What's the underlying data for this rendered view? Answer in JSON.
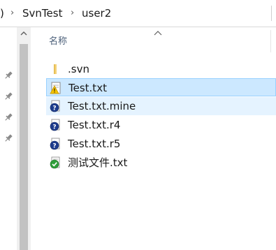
{
  "breadcrumb": {
    "leading_glyph": ")",
    "separator": "›",
    "segments": [
      "SvnTest",
      "user2"
    ]
  },
  "file_list": {
    "column_header": "名称",
    "sort": "ascending",
    "items": [
      {
        "name": ".svn",
        "icon": "folder-icon",
        "state": "normal"
      },
      {
        "name": "Test.txt",
        "icon": "svn-conflict-icon",
        "state": "selected-focused"
      },
      {
        "name": "Test.txt.mine",
        "icon": "svn-unversioned-icon",
        "state": "selected"
      },
      {
        "name": "Test.txt.r4",
        "icon": "svn-unversioned-icon",
        "state": "normal"
      },
      {
        "name": "Test.txt.r5",
        "icon": "svn-unversioned-icon",
        "state": "normal"
      },
      {
        "name": "测试文件.txt",
        "icon": "svn-normal-icon",
        "state": "normal"
      }
    ]
  },
  "nav_pane": {
    "pins": [
      "pin-icon",
      "pin-icon",
      "pin-icon",
      "pin-icon"
    ]
  },
  "colors": {
    "selection_focus_bg": "#cce8ff",
    "selection_focus_border": "#99d1ff",
    "selection_bg": "#e5f3ff",
    "header_text": "#4c607a",
    "svn_unversioned_blue": "#1e3c8c",
    "svn_conflict_yellow": "#f5c400",
    "svn_normal_green": "#2e9e3a",
    "folder_yellow": "#f4d279"
  }
}
